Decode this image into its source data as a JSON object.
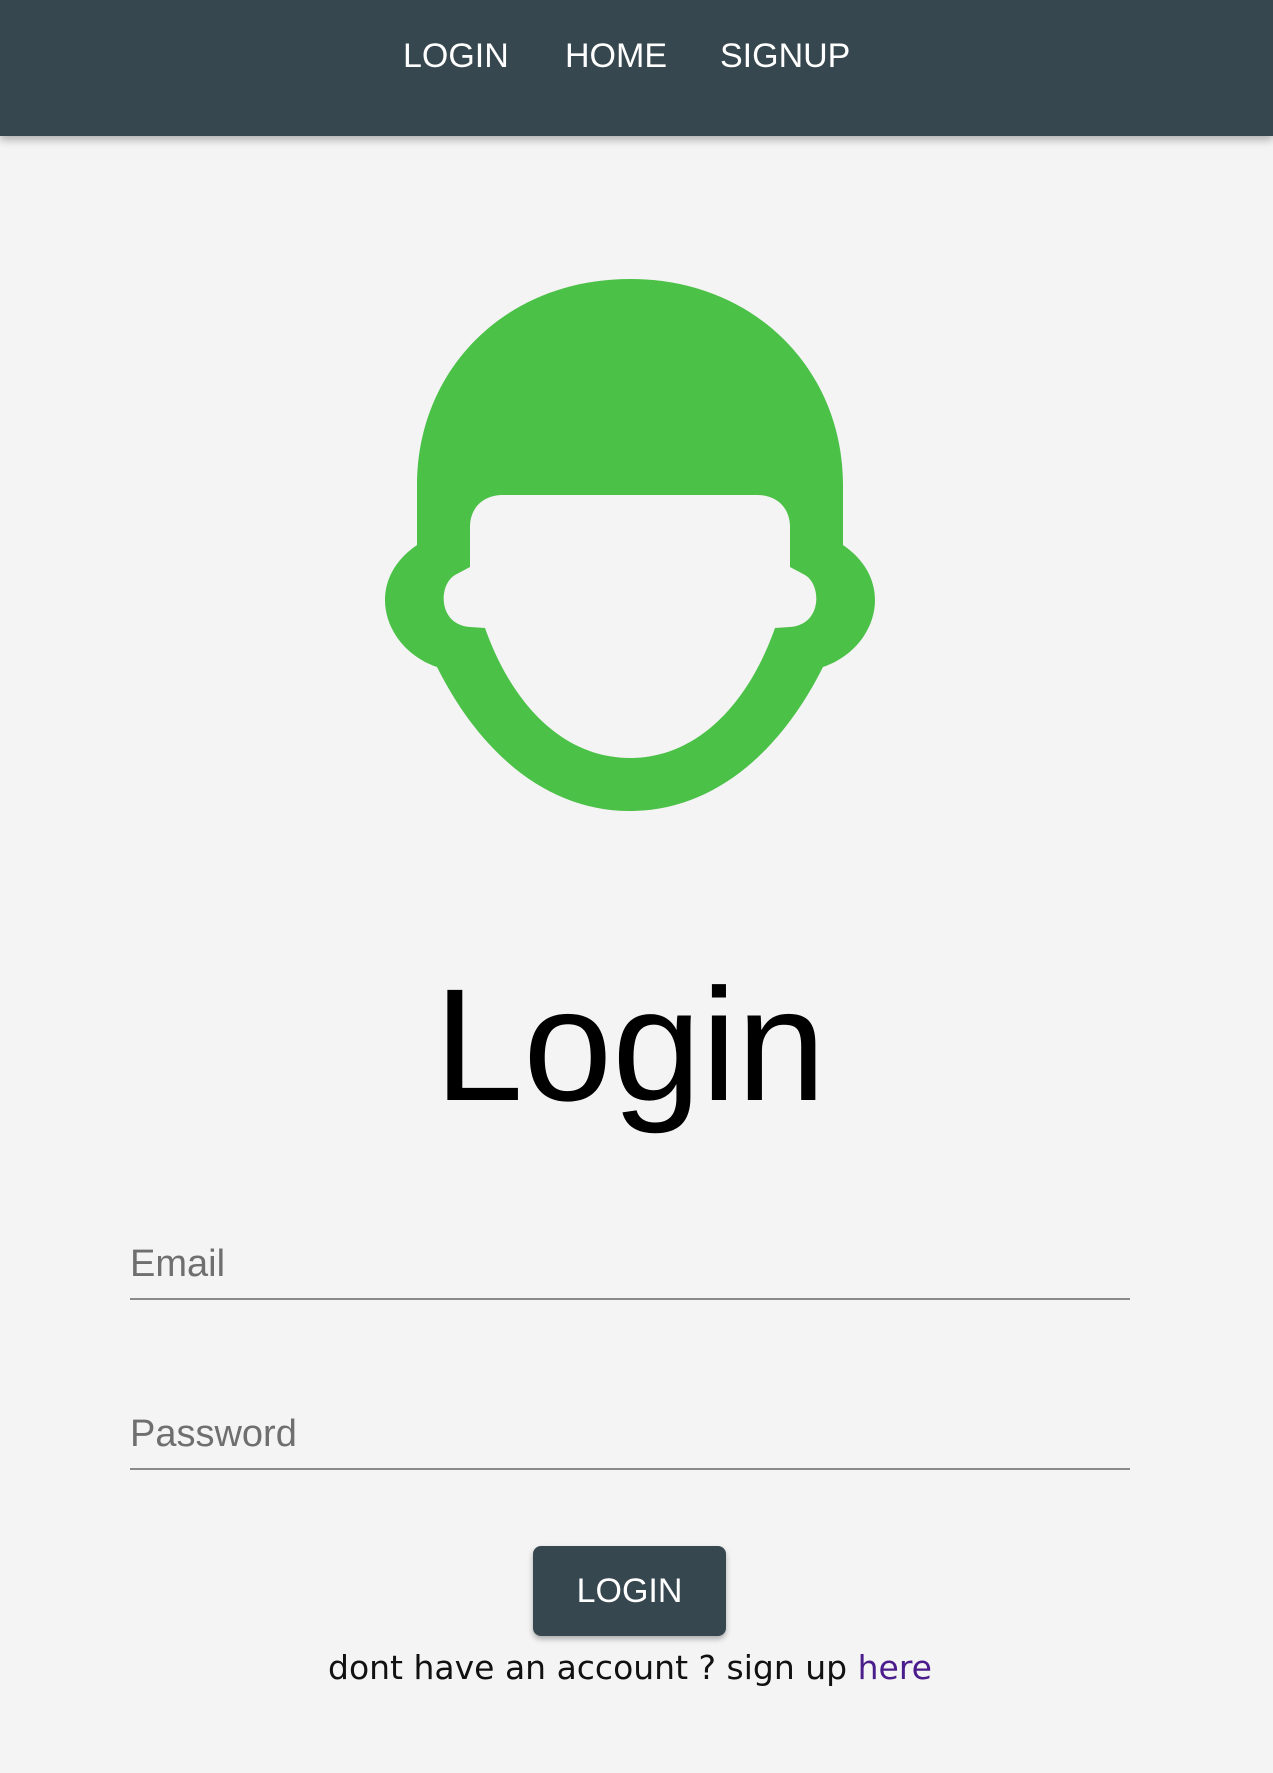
{
  "navbar": {
    "links": [
      {
        "label": "LOGIN"
      },
      {
        "label": "HOME"
      },
      {
        "label": "SIGNUP"
      }
    ],
    "background_color": "#37474f"
  },
  "avatar": {
    "icon": "user-head-icon",
    "color": "#4cc148"
  },
  "page": {
    "title": "Login"
  },
  "form": {
    "email": {
      "placeholder": "Email",
      "value": ""
    },
    "password": {
      "placeholder": "Password",
      "value": ""
    },
    "submit_label": "LOGIN"
  },
  "footer": {
    "prompt": "dont have an account ? sign up",
    "link_label": "here",
    "link_color": "#4a1c8c"
  }
}
